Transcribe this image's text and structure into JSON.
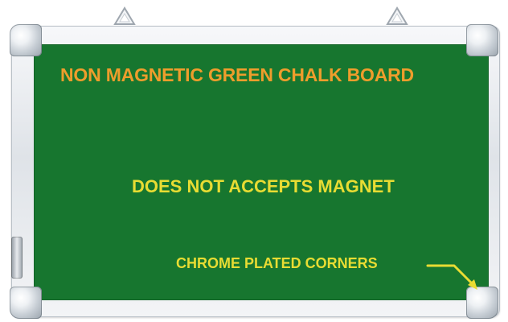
{
  "board": {
    "title": "NON MAGNETIC GREEN CHALK BOARD",
    "subtitle": "DOES NOT ACCEPTS MAGNET",
    "corner_note": "CHROME PLATED CORNERS"
  },
  "colors": {
    "board": "#17762f",
    "title": "#ee9d2c",
    "text": "#e8dc33",
    "frame": "#dfe3e8"
  },
  "icons": {
    "hanger": "triangle-hanger-icon",
    "arrow": "arrow-right-down-icon"
  }
}
